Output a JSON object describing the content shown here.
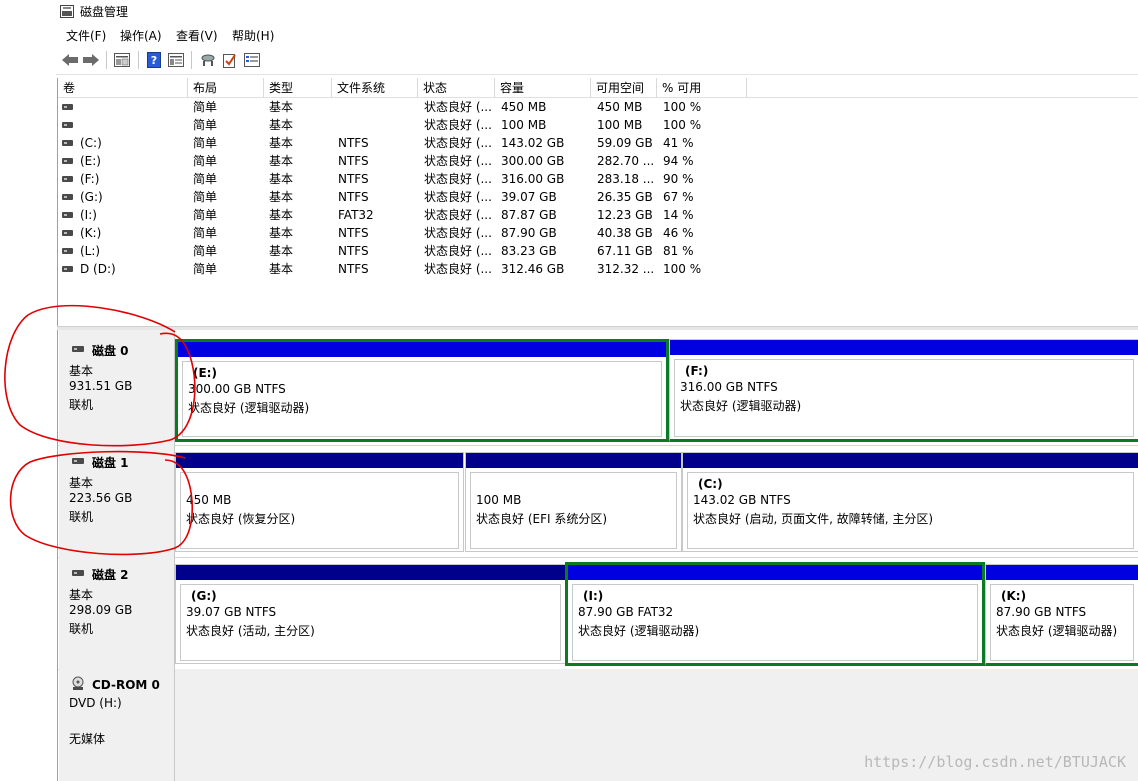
{
  "window": {
    "title": "磁盘管理"
  },
  "menu": [
    "文件(F)",
    "操作(A)",
    "查看(V)",
    "帮助(H)"
  ],
  "toolbar": {
    "buttons": [
      "back-arrow-icon",
      "forward-arrow-icon",
      "disk-list-icon",
      "help-icon",
      "properties-icon",
      "connect-icon",
      "check-icon",
      "settings-icon"
    ]
  },
  "volume_table": {
    "columns": [
      "卷",
      "布局",
      "类型",
      "文件系统",
      "状态",
      "容量",
      "可用空间",
      "% 可用"
    ],
    "rows": [
      {
        "vol": "",
        "layout": "简单",
        "type": "基本",
        "fs": "",
        "status": "状态良好 (...",
        "cap": "450 MB",
        "free": "450 MB",
        "pct": "100 %"
      },
      {
        "vol": "",
        "layout": "简单",
        "type": "基本",
        "fs": "",
        "status": "状态良好 (...",
        "cap": "100 MB",
        "free": "100 MB",
        "pct": "100 %"
      },
      {
        "vol": "(C:)",
        "layout": "简单",
        "type": "基本",
        "fs": "NTFS",
        "status": "状态良好 (...",
        "cap": "143.02 GB",
        "free": "59.09 GB",
        "pct": "41 %"
      },
      {
        "vol": "(E:)",
        "layout": "简单",
        "type": "基本",
        "fs": "NTFS",
        "status": "状态良好 (...",
        "cap": "300.00 GB",
        "free": "282.70 ...",
        "pct": "94 %"
      },
      {
        "vol": "(F:)",
        "layout": "简单",
        "type": "基本",
        "fs": "NTFS",
        "status": "状态良好 (...",
        "cap": "316.00 GB",
        "free": "283.18 ...",
        "pct": "90 %"
      },
      {
        "vol": "(G:)",
        "layout": "简单",
        "type": "基本",
        "fs": "NTFS",
        "status": "状态良好 (...",
        "cap": "39.07 GB",
        "free": "26.35 GB",
        "pct": "67 %"
      },
      {
        "vol": "(I:)",
        "layout": "简单",
        "type": "基本",
        "fs": "FAT32",
        "status": "状态良好 (...",
        "cap": "87.87 GB",
        "free": "12.23 GB",
        "pct": "14 %"
      },
      {
        "vol": "(K:)",
        "layout": "简单",
        "type": "基本",
        "fs": "NTFS",
        "status": "状态良好 (...",
        "cap": "87.90 GB",
        "free": "40.38 GB",
        "pct": "46 %"
      },
      {
        "vol": "(L:)",
        "layout": "简单",
        "type": "基本",
        "fs": "NTFS",
        "status": "状态良好 (...",
        "cap": "83.23 GB",
        "free": "67.11 GB",
        "pct": "81 %"
      },
      {
        "vol": "D (D:)",
        "layout": "简单",
        "type": "基本",
        "fs": "NTFS",
        "status": "状态良好 (...",
        "cap": "312.46 GB",
        "free": "312.32 ...",
        "pct": "100 %"
      }
    ]
  },
  "disks": [
    {
      "name": "磁盘 0",
      "type": "基本",
      "size": "931.51 GB",
      "state": "联机",
      "partitions": [
        {
          "label": "(E:)",
          "size": "300.00 GB NTFS",
          "status": "状态良好 (逻辑驱动器)"
        },
        {
          "label": "(F:)",
          "size": "316.00 GB NTFS",
          "status": "状态良好 (逻辑驱动器)"
        }
      ]
    },
    {
      "name": "磁盘 1",
      "type": "基本",
      "size": "223.56 GB",
      "state": "联机",
      "partitions": [
        {
          "label": "",
          "size": "450 MB",
          "status": "状态良好 (恢复分区)"
        },
        {
          "label": "",
          "size": "100 MB",
          "status": "状态良好 (EFI 系统分区)"
        },
        {
          "label": "(C:)",
          "size": "143.02 GB NTFS",
          "status": "状态良好 (启动, 页面文件, 故障转储, 主分区)"
        }
      ]
    },
    {
      "name": "磁盘 2",
      "type": "基本",
      "size": "298.09 GB",
      "state": "联机",
      "partitions": [
        {
          "label": "(G:)",
          "size": "39.07 GB NTFS",
          "status": "状态良好 (活动, 主分区)"
        },
        {
          "label": "(I:)",
          "size": "87.90 GB FAT32",
          "status": "状态良好 (逻辑驱动器)"
        },
        {
          "label": "(K:)",
          "size": "87.90 GB NTFS",
          "status": "状态良好 (逻辑驱动器)"
        }
      ]
    },
    {
      "name": "CD-ROM 0",
      "type": "DVD (H:)",
      "size": "",
      "state": "无媒体",
      "partitions": []
    }
  ],
  "watermark": "https://blog.csdn.net/BTUJACK",
  "colors": {
    "primary_bar": "#00008a",
    "logical_bar": "#0000e0",
    "selected_border": "#0b7a23",
    "annotation": "#e00000"
  }
}
